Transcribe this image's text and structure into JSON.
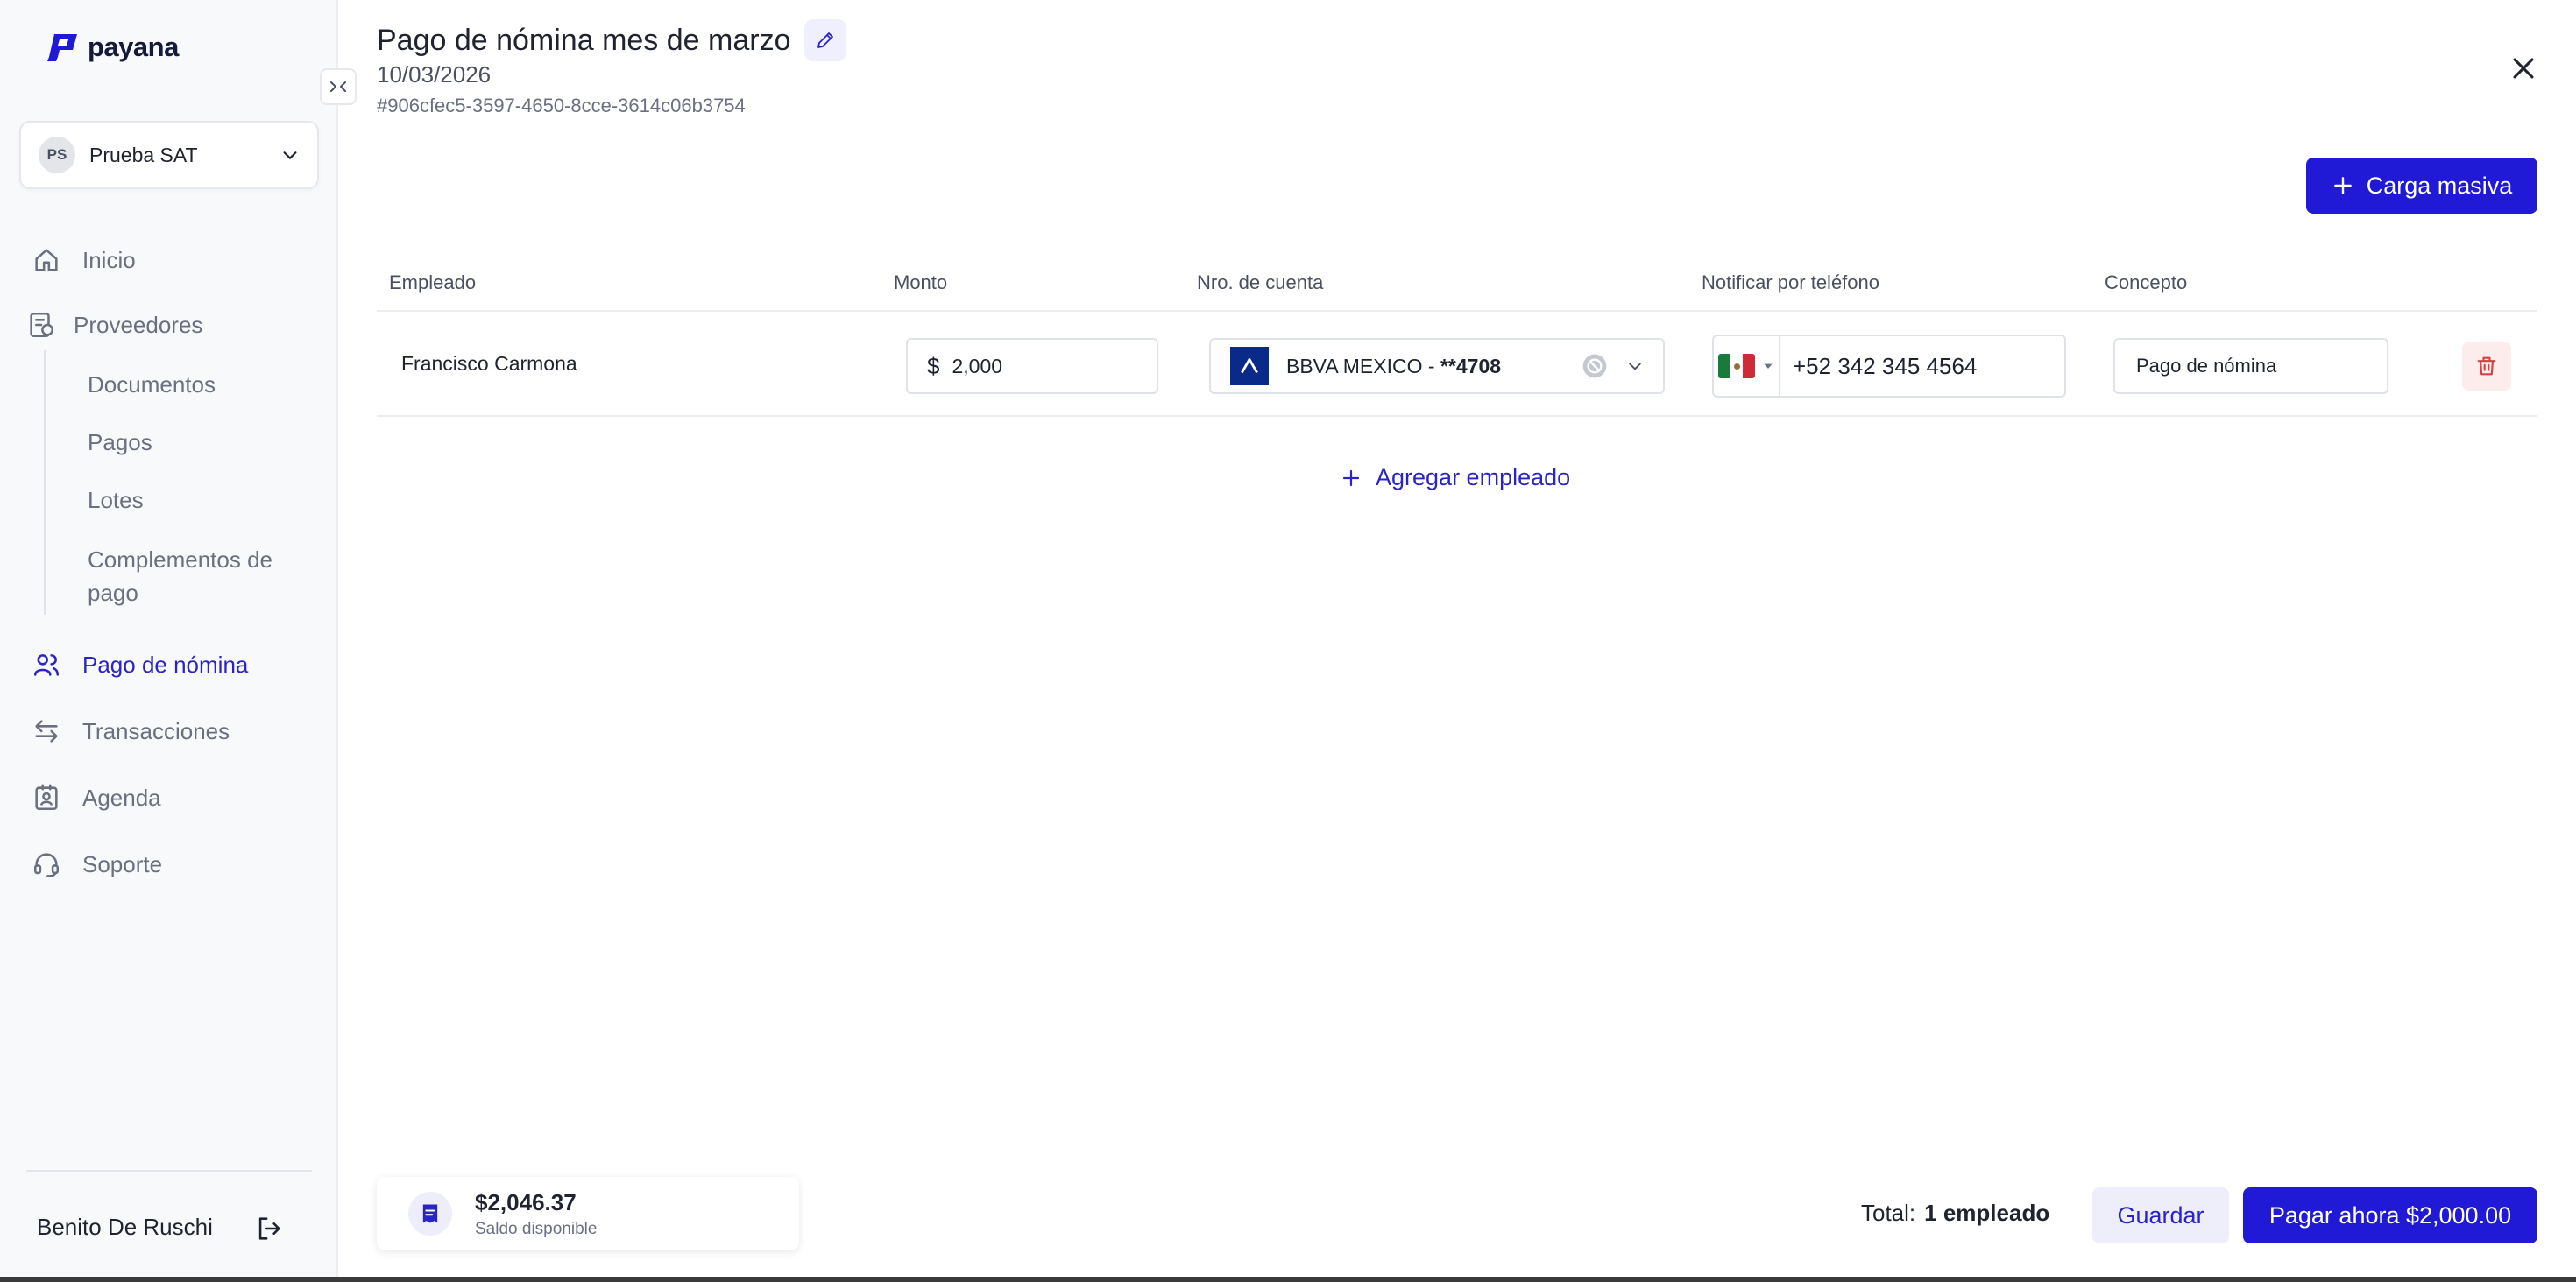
{
  "app": {
    "logo_text": "payana"
  },
  "company": {
    "initials": "PS",
    "name": "Prueba SAT"
  },
  "nav": {
    "inicio": "Inicio",
    "proveedores": "Proveedores",
    "documentos": "Documentos",
    "pagos": "Pagos",
    "lotes": "Lotes",
    "complementos_1": "Complementos de",
    "complementos_2": "pago",
    "pago_nomina": "Pago de nómina",
    "transacciones": "Transacciones",
    "agenda": "Agenda",
    "soporte": "Soporte"
  },
  "user": {
    "name": "Benito De Ruschi"
  },
  "header": {
    "title": "Pago de nómina mes de marzo",
    "date": "10/03/2026",
    "id": "#906cfec5-3597-4650-8cce-3614c06b3754"
  },
  "toolbar": {
    "bulk_upload_label": "Carga masiva"
  },
  "table": {
    "headers": {
      "empleado": "Empleado",
      "monto": "Monto",
      "cuenta": "Nro. de cuenta",
      "telefono": "Notificar por teléfono",
      "concepto": "Concepto"
    },
    "rows": [
      {
        "empleado": "Francisco Carmona",
        "currency": "$",
        "monto": "2,000",
        "bank": "BBVA MEXICO - ",
        "account": "**4708",
        "phone": "+52 342 345 4564",
        "concepto": "Pago de nómina"
      }
    ]
  },
  "actions": {
    "add_employee": "Agregar empleado"
  },
  "footer": {
    "balance": "$2,046.37",
    "balance_label": "Saldo disponible",
    "total_label": "Total:",
    "total_value": "1 empleado",
    "save_label": "Guardar",
    "pay_label": "Pagar ahora $2,000.00"
  },
  "colors": {
    "primary": "#2019d6",
    "accent_text": "#2a24c8",
    "danger": "#d14343"
  }
}
